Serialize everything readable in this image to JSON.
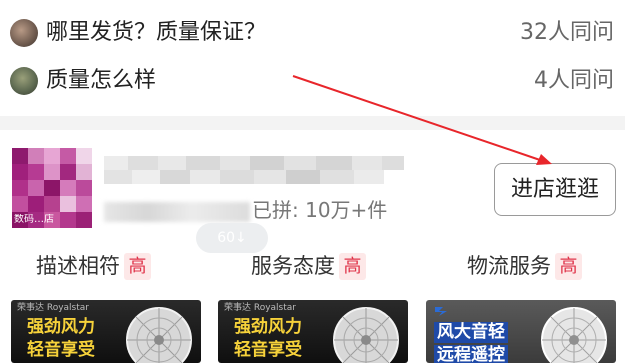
{
  "qa": {
    "items": [
      {
        "question": "哪里发货？质量保证？",
        "count": "32人同问"
      },
      {
        "question": "质量怎么样",
        "count": "4人同问"
      }
    ]
  },
  "shop": {
    "logo_caption": "数码…店",
    "sales_label": "已拼: 10万+件",
    "ghost_label": "60↓",
    "visit_button": "进店逛逛",
    "ratings": [
      {
        "label": "描述相符",
        "level": "高"
      },
      {
        "label": "服务态度",
        "level": "高"
      },
      {
        "label": "物流服务",
        "level": "高"
      }
    ]
  },
  "products": [
    {
      "brand": "荣事达 Royalstar",
      "line1": "强劲风力",
      "line2": "轻音享受"
    },
    {
      "brand": "荣事达 Royalstar",
      "line1": "强劲风力",
      "line2": "轻音享受"
    },
    {
      "brand": "",
      "line1": "风大音轻",
      "line2": "远程遥控"
    }
  ],
  "colors": {
    "accent_red": "#e0344a",
    "badge_bg": "#fde8e8",
    "annotation_arrow": "#e8262b",
    "promo_yellow": "#f7d23a"
  }
}
